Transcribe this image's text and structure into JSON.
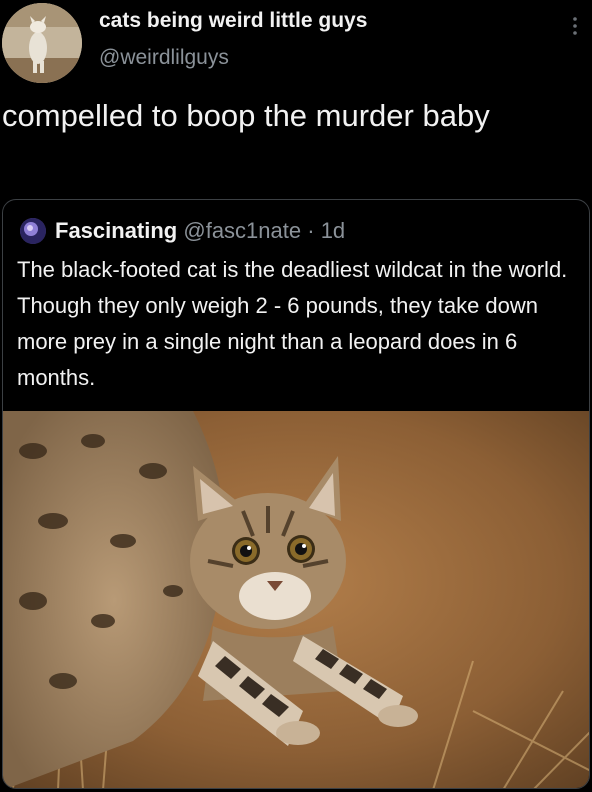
{
  "tweet": {
    "display_name": "cats being weird little guys",
    "handle": "@weirdlilguys",
    "text": "compelled to boop the murder baby"
  },
  "quoted_tweet": {
    "display_name": "Fascinating",
    "handle": "@fasc1nate",
    "separator": "·",
    "timestamp": "1d",
    "text": "The black-footed cat is the deadliest wildcat in the world. Though they only weigh 2 - 6 pounds, they take down more prey in a single night than a leopard does in 6 months."
  },
  "icons": {
    "more": "more-vertical-icon",
    "avatar": "user-avatar",
    "quoted_avatar": "quoted-user-avatar"
  },
  "media": {
    "subject": "black-footed cat crouching on sandy ground"
  },
  "colors": {
    "background": "#000000",
    "text_primary": "#f2f2f2",
    "text_secondary": "#8b9299",
    "border": "#3c4044"
  }
}
